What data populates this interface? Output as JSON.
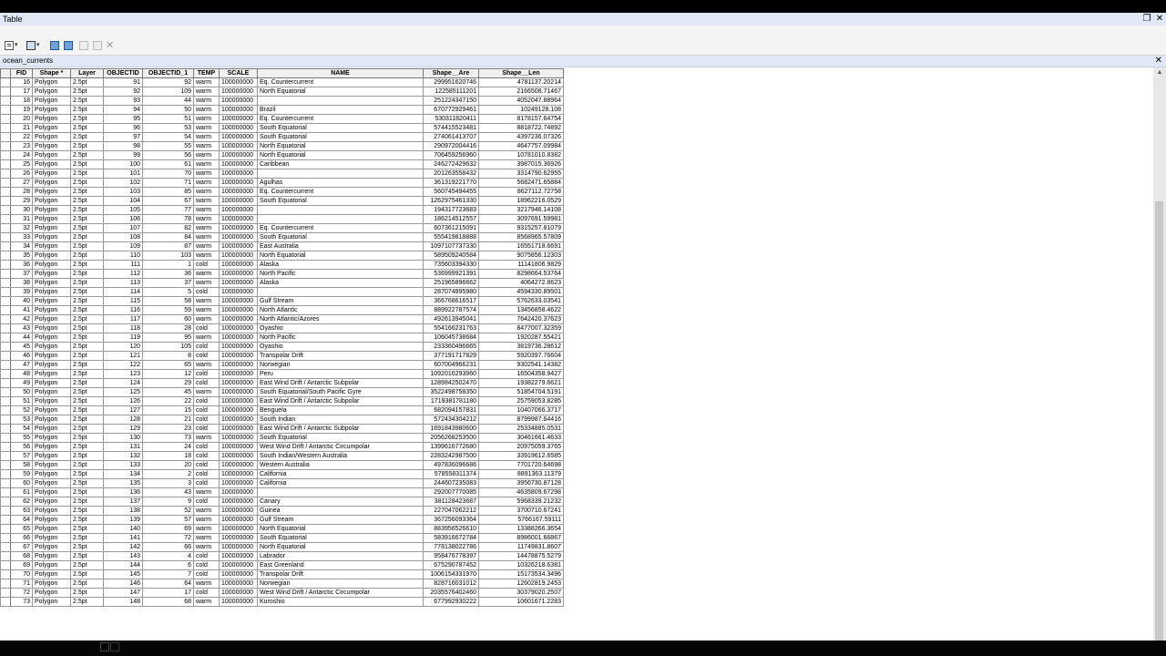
{
  "window": {
    "title": "Table"
  },
  "toolbar": {
    "icons": [
      "table-options-icon",
      "related-tables-icon",
      "select-by-attributes-icon",
      "switch-selection-icon",
      "clear-selection-icon",
      "zoom-to-selected-icon",
      "delete-selected-icon"
    ]
  },
  "tab": {
    "name": "ocean_currents"
  },
  "columns": [
    "FID",
    "Shape *",
    "Layer",
    "OBJECTID",
    "OBJECTID_1",
    "TEMP",
    "SCALE",
    "NAME",
    "Shape__Are",
    "Shape__Len"
  ],
  "rows": [
    [
      "16",
      "Polygon",
      "2.5pt",
      "91",
      "92",
      "warm",
      "100000000",
      "Eq. Countercurrent",
      "299951620746",
      "4781137.20214"
    ],
    [
      "17",
      "Polygon",
      "2.5pt",
      "92",
      "109",
      "warm",
      "100000000",
      "North Equatorial",
      "122585111201",
      "2166508.71467"
    ],
    [
      "18",
      "Polygon",
      "2.5pt",
      "93",
      "44",
      "warm",
      "100000000",
      "",
      "251224347150",
      "4052047.88964"
    ],
    [
      "19",
      "Polygon",
      "2.5pt",
      "94",
      "50",
      "warm",
      "100000000",
      "Brazil",
      "670772929461",
      "10249128.108"
    ],
    [
      "20",
      "Polygon",
      "2.5pt",
      "95",
      "51",
      "warm",
      "100000000",
      "Eq. Countercurrent",
      "530311820411",
      "8178157.64754"
    ],
    [
      "21",
      "Polygon",
      "2.5pt",
      "96",
      "53",
      "warm",
      "100000000",
      "South Equatorial",
      "574415523481",
      "8818722.74892"
    ],
    [
      "22",
      "Polygon",
      "2.5pt",
      "97",
      "54",
      "warm",
      "100000000",
      "South Equatorial",
      "274061413707",
      "4397236.07326"
    ],
    [
      "23",
      "Polygon",
      "2.5pt",
      "98",
      "55",
      "warm",
      "100000000",
      "North Equatorial",
      "290972004416",
      "4647757.09984"
    ],
    [
      "24",
      "Polygon",
      "2.5pt",
      "99",
      "56",
      "warm",
      "100000000",
      "North Equatorial",
      "706459256960",
      "10781010.8382"
    ],
    [
      "25",
      "Polygon",
      "2.5pt",
      "100",
      "61",
      "warm",
      "100000000",
      "Caribbean",
      "246272429632",
      "3987015.36926"
    ],
    [
      "26",
      "Polygon",
      "2.5pt",
      "101",
      "70",
      "warm",
      "100000000",
      "",
      "201263558432",
      "3314790.62955"
    ],
    [
      "27",
      "Polygon",
      "2.5pt",
      "102",
      "71",
      "warm",
      "100000000",
      "Agulhas",
      "361319221770",
      "5682471.65884"
    ],
    [
      "28",
      "Polygon",
      "2.5pt",
      "103",
      "85",
      "warm",
      "100000000",
      "Eq. Countercurrent",
      "560745494455",
      "8627112.72758"
    ],
    [
      "29",
      "Polygon",
      "2.5pt",
      "104",
      "67",
      "warm",
      "100000000",
      "South Equatorial",
      "1262975461330",
      "18962216.0529"
    ],
    [
      "30",
      "Polygon",
      "2.5pt",
      "105",
      "77",
      "warm",
      "100000000",
      "",
      "194317723683",
      "3217946.14108"
    ],
    [
      "31",
      "Polygon",
      "2.5pt",
      "106",
      "78",
      "warm",
      "100000000",
      "",
      "186214512557",
      "3097691.59981"
    ],
    [
      "32",
      "Polygon",
      "2.5pt",
      "107",
      "82",
      "warm",
      "100000000",
      "Eq. Countercurrent",
      "607361215091",
      "9315257.81079"
    ],
    [
      "33",
      "Polygon",
      "2.5pt",
      "108",
      "84",
      "warm",
      "100000000",
      "South Equatorial",
      "555419818888",
      "8568965.57809"
    ],
    [
      "34",
      "Polygon",
      "2.5pt",
      "109",
      "87",
      "warm",
      "100000000",
      "East Australia",
      "1097107737330",
      "16551718.6691"
    ],
    [
      "35",
      "Polygon",
      "2.5pt",
      "110",
      "103",
      "warm",
      "100000000",
      "North Equatorial",
      "589509240584",
      "9075856.12303"
    ],
    [
      "36",
      "Polygon",
      "2.5pt",
      "111",
      "1",
      "cold",
      "100000000",
      "Alaska",
      "735603394330",
      "11141806.9829"
    ],
    [
      "37",
      "Polygon",
      "2.5pt",
      "112",
      "36",
      "warm",
      "100000000",
      "North Pacific",
      "536999921391",
      "8298664.53764"
    ],
    [
      "38",
      "Polygon",
      "2.5pt",
      "113",
      "37",
      "warm",
      "100000000",
      "Alaska",
      "251965896662",
      "4064272.8623"
    ],
    [
      "39",
      "Polygon",
      "2.5pt",
      "114",
      "5",
      "cold",
      "100000000",
      "",
      "287074895980",
      "4594330.89501"
    ],
    [
      "40",
      "Polygon",
      "2.5pt",
      "115",
      "58",
      "warm",
      "100000000",
      "Gulf Stream",
      "366768616517",
      "5762633.03541"
    ],
    [
      "41",
      "Polygon",
      "2.5pt",
      "116",
      "59",
      "warm",
      "100000000",
      "North Atlantic",
      "889922787574",
      "13456858.4622"
    ],
    [
      "42",
      "Polygon",
      "2.5pt",
      "117",
      "60",
      "warm",
      "100000000",
      "North Atlantic/Azores",
      "492613945041",
      "7642420.37623"
    ],
    [
      "43",
      "Polygon",
      "2.5pt",
      "118",
      "28",
      "cold",
      "100000000",
      "Oyashio",
      "554166231763",
      "8477007.32359"
    ],
    [
      "44",
      "Polygon",
      "2.5pt",
      "119",
      "95",
      "warm",
      "100000000",
      "North Pacific",
      "106045738684",
      "1920287.55421"
    ],
    [
      "45",
      "Polygon",
      "2.5pt",
      "120",
      "105",
      "cold",
      "100000000",
      "Oyashio",
      "233360496665",
      "3819736.28612"
    ],
    [
      "46",
      "Polygon",
      "2.5pt",
      "121",
      "8",
      "cold",
      "100000000",
      "Transpolar Drift",
      "377191717829",
      "5920397.76604"
    ],
    [
      "47",
      "Polygon",
      "2.5pt",
      "122",
      "65",
      "warm",
      "100000000",
      "Norwegian",
      "607004966231",
      "9302541.14382"
    ],
    [
      "48",
      "Polygon",
      "2.5pt",
      "123",
      "12",
      "cold",
      "100000000",
      "Peru",
      "1092016293960",
      "16504358.9427"
    ],
    [
      "49",
      "Polygon",
      "2.5pt",
      "124",
      "29",
      "cold",
      "100000000",
      "East Wind Drift / Antarctic Subpolar",
      "1289842502470",
      "19382279.6621"
    ],
    [
      "50",
      "Polygon",
      "2.5pt",
      "125",
      "45",
      "warm",
      "100000000",
      "South Equatorial/South Pacific Gyre",
      "3522498758350",
      "51854704.5191"
    ],
    [
      "51",
      "Polygon",
      "2.5pt",
      "126",
      "22",
      "cold",
      "100000000",
      "East Wind Drift / Antarctic Subpolar",
      "1719381781180",
      "25759053.8285"
    ],
    [
      "52",
      "Polygon",
      "2.5pt",
      "127",
      "15",
      "cold",
      "100000000",
      "Benguela",
      "682094157831",
      "10407066.3717"
    ],
    [
      "53",
      "Polygon",
      "2.5pt",
      "128",
      "21",
      "cold",
      "100000000",
      "South Indian",
      "572434304212",
      "8799987.64416"
    ],
    [
      "54",
      "Polygon",
      "2.5pt",
      "129",
      "23",
      "cold",
      "100000000",
      "East Wind Drift / Antarctic Subpolar",
      "1691843980600",
      "25334885.0531"
    ],
    [
      "55",
      "Polygon",
      "2.5pt",
      "130",
      "73",
      "warm",
      "100000000",
      "South Equatorial",
      "2056268253500",
      "30461661.4633"
    ],
    [
      "56",
      "Polygon",
      "2.5pt",
      "131",
      "24",
      "cold",
      "100000000",
      "West Wind Drift / Antarctic Circumpolar",
      "1399616772680",
      "20975059.3765"
    ],
    [
      "57",
      "Polygon",
      "2.5pt",
      "132",
      "18",
      "cold",
      "100000000",
      "South Indian/Western Australia",
      "2283242987500",
      "33919612.6585"
    ],
    [
      "58",
      "Polygon",
      "2.5pt",
      "133",
      "20",
      "cold",
      "100000000",
      "Western Australia",
      "497836096686",
      "7701720.64698"
    ],
    [
      "59",
      "Polygon",
      "2.5pt",
      "134",
      "2",
      "cold",
      "100000000",
      "California",
      "578558311374",
      "8891363.11379"
    ],
    [
      "60",
      "Polygon",
      "2.5pt",
      "135",
      "3",
      "cold",
      "100000000",
      "California",
      "244607235083",
      "3956730.87128"
    ],
    [
      "61",
      "Polygon",
      "2.5pt",
      "136",
      "43",
      "warm",
      "100000000",
      "",
      "292007770085",
      "4635809.67298"
    ],
    [
      "62",
      "Polygon",
      "2.5pt",
      "137",
      "9",
      "cold",
      "100000000",
      "Canary",
      "381128423687",
      "5968339.21232"
    ],
    [
      "63",
      "Polygon",
      "2.5pt",
      "138",
      "52",
      "warm",
      "100000000",
      "Guinea",
      "227047062212",
      "3700710.67241"
    ],
    [
      "64",
      "Polygon",
      "2.5pt",
      "139",
      "57",
      "warm",
      "100000000",
      "Gulf Stream",
      "367256093364",
      "5766167.59111"
    ],
    [
      "65",
      "Polygon",
      "2.5pt",
      "140",
      "69",
      "warm",
      "100000000",
      "North Equatorial",
      "883956526610",
      "13388266.3654"
    ],
    [
      "66",
      "Polygon",
      "2.5pt",
      "141",
      "72",
      "warm",
      "100000000",
      "South Equatorial",
      "583916672784",
      "8986001.66867"
    ],
    [
      "67",
      "Polygon",
      "2.5pt",
      "142",
      "66",
      "warm",
      "100000000",
      "North Equatorial",
      "778138022786",
      "11749831.8607"
    ],
    [
      "68",
      "Polygon",
      "2.5pt",
      "143",
      "4",
      "cold",
      "100000000",
      "Labrador",
      "958476778397",
      "14478875.5279"
    ],
    [
      "69",
      "Polygon",
      "2.5pt",
      "144",
      "6",
      "cold",
      "100000000",
      "East Greenland",
      "675290787452",
      "10326218.6381"
    ],
    [
      "70",
      "Polygon",
      "2.5pt",
      "145",
      "7",
      "cold",
      "100000000",
      "Transpolar Drift",
      "1006154331970",
      "15173534.3496"
    ],
    [
      "71",
      "Polygon",
      "2.5pt",
      "146",
      "64",
      "warm",
      "100000000",
      "Norwegian",
      "828716031012",
      "12602819.2453"
    ],
    [
      "72",
      "Polygon",
      "2.5pt",
      "147",
      "17",
      "cold",
      "100000000",
      "West Wind Drift / Antarctic Circumpolar",
      "2035576402460",
      "30379020.2507"
    ],
    [
      "73",
      "Polygon",
      "2.5pt",
      "148",
      "68",
      "warm",
      "100000000",
      "Kuroshio",
      "677992930222",
      "10601671.2283"
    ]
  ]
}
